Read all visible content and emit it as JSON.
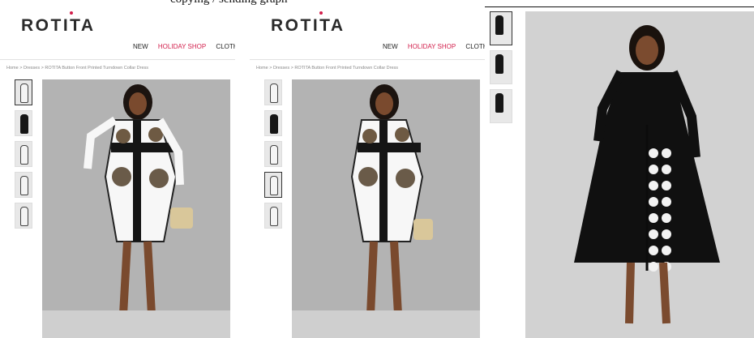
{
  "screenshot_caption_fragment": "copying / sending graph",
  "store": {
    "logo": "ROTITA",
    "nav": [
      "NEW",
      "HOLIDAY SHOP",
      "CLOTHIN"
    ],
    "breadcrumb": "Home > Dresses > ROTITA Button Front Printed Turndown Collar Dress"
  },
  "panel2": {
    "logo": "ROTITA",
    "nav": [
      "NEW",
      "HOLIDAY SHOP",
      "CLOTHIN"
    ],
    "breadcrumb": "Home > Dresses > ROTITA Button Front Printed Turndown Collar Dress"
  },
  "colors": {
    "brand_accent": "#d21e4b",
    "dress_black": "#111111",
    "dress_white": "#f4f4f4"
  },
  "icons": [
    "thumbnail-image",
    "product-photo"
  ]
}
